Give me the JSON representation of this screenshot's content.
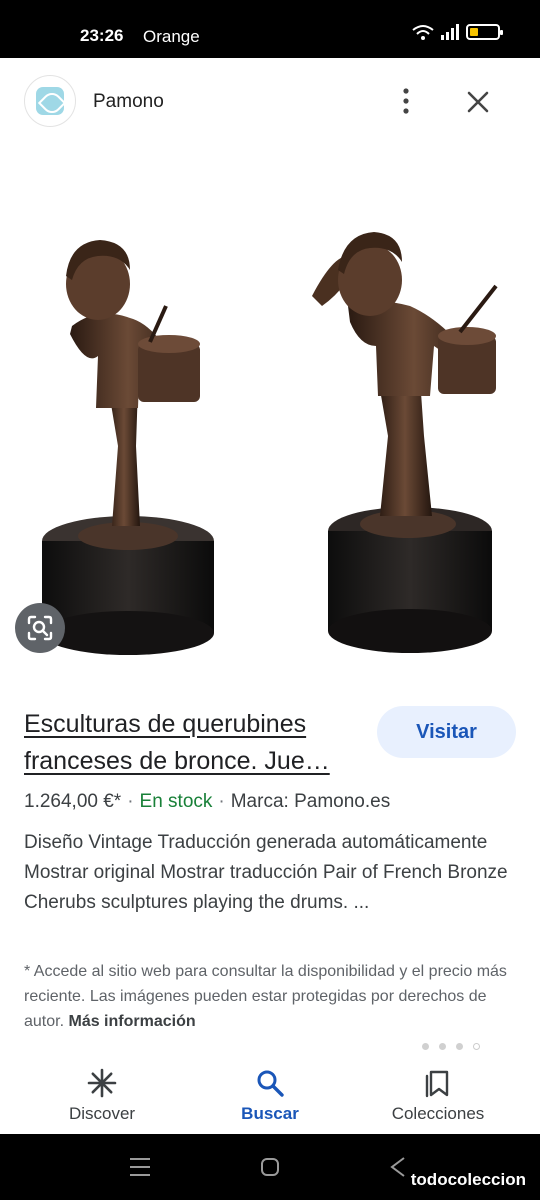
{
  "status_bar": {
    "time": "23:26",
    "carrier": "Orange"
  },
  "header": {
    "site_name": "Pamono",
    "logo_icon": "pamono-logo-icon"
  },
  "product": {
    "title_line1": "Esculturas de querubines",
    "title_line2": "franceses de bronce. Jue…",
    "visit_label": "Visitar",
    "price": "1.264,00 €*",
    "stock": "En stock",
    "brand": "Marca: Pamono.es",
    "separator": "·",
    "description": "Diseño Vintage Traducción generada automáticamente Mostrar original Mostrar traducción Pair of French Bronze Cherubs sculptures playing the drums. ...",
    "disclaimer": "* Accede al sitio web para consultar la disponibilidad y el precio más reciente. Las imágenes pueden estar protegidas por derechos de autor.",
    "more_info": "Más información"
  },
  "bottom_nav": {
    "items": [
      {
        "label": "Discover",
        "icon": "asterisk-icon",
        "active": false
      },
      {
        "label": "Buscar",
        "icon": "search-icon",
        "active": true
      },
      {
        "label": "Colecciones",
        "icon": "bookmark-icon",
        "active": false
      }
    ]
  },
  "watermark": "todocoleccion",
  "colors": {
    "accent": "#1a56b8",
    "stock_green": "#188038",
    "visit_bg": "#e8f0fe"
  }
}
